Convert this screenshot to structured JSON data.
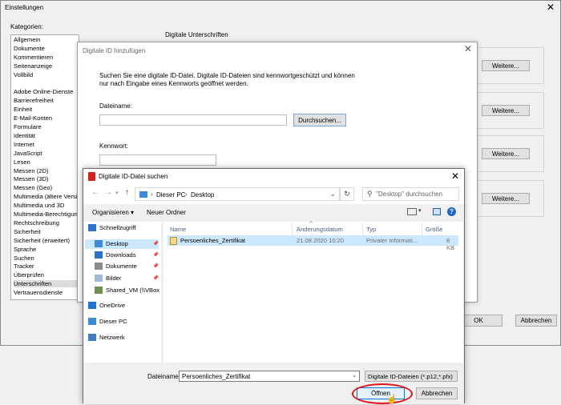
{
  "main": {
    "title": "Einstellungen",
    "categories_label": "Kategorien:",
    "categories": [
      "Allgemein",
      "Dokumente",
      "Kommentieren",
      "Seitenanzeige",
      "Vollbild",
      "",
      "Adobe Online-Dienste",
      "Barrierefreiheit",
      "Einheit",
      "E-Mail-Konten",
      "Formulare",
      "Identität",
      "Internet",
      "JavaScript",
      "Lesen",
      "Messen (2D)",
      "Messen (3D)",
      "Messen (Geo)",
      "Multimedia (ältere Versionen)",
      "Multimedia und 3D",
      "Multimedia-Berechtigungen",
      "Rechtschreibung",
      "Sicherheit",
      "Sicherheit (erweitert)",
      "Sprache",
      "Suchen",
      "Tracker",
      "Überprüfen",
      "Unterschriften",
      "Vertrauensdienste"
    ],
    "selected_category": "Unterschriften",
    "section_title": "Digitale Unterschriften",
    "more_button": "Weitere...",
    "ok_button": "OK",
    "cancel_button": "Abbrechen"
  },
  "add_id": {
    "title": "Digitale ID hinzufügen",
    "description": "Suchen Sie eine digitale ID-Datei. Digitale ID-Dateien sind kennwortgeschützt und können nur nach Eingabe eines Kennworts geöffnet werden.",
    "filename_label": "Dateiname:",
    "filename_value": "",
    "browse_button": "Durchsuchen...",
    "password_label": "Kennwort:",
    "password_value": ""
  },
  "file_dialog": {
    "title": "Digitale ID-Datei suchen",
    "breadcrumb": [
      "Dieser PC",
      "Desktop"
    ],
    "search_placeholder": "\"Desktop\" durchsuchen",
    "organize_label": "Organisieren ▾",
    "new_folder_label": "Neuer Ordner",
    "nav_items": [
      {
        "label": "Schnellzugriff",
        "icon": "star-icon",
        "pinned": false
      },
      {
        "label": "Desktop",
        "icon": "desktop-icon",
        "pinned": true
      },
      {
        "label": "Downloads",
        "icon": "download-icon",
        "pinned": true
      },
      {
        "label": "Dokumente",
        "icon": "documents-icon",
        "pinned": true
      },
      {
        "label": "Bilder",
        "icon": "pictures-icon",
        "pinned": true
      },
      {
        "label": "Shared_VM (\\\\VBox",
        "icon": "network-drive-icon",
        "pinned": false
      },
      {
        "label": "OneDrive",
        "icon": "cloud-icon",
        "pinned": false
      },
      {
        "label": "Dieser PC",
        "icon": "computer-icon",
        "pinned": false
      },
      {
        "label": "Netzwerk",
        "icon": "network-icon",
        "pinned": false
      }
    ],
    "columns": [
      "Name",
      "Änderungsdatum",
      "Typ",
      "Größe"
    ],
    "files": [
      {
        "name": "Persoenliches_Zertifikat",
        "date": "21.08.2020 10:20",
        "type": "Privater Informati...",
        "size": "8 KB"
      }
    ],
    "filename_label": "Dateiname:",
    "filename_value": "Persoenliches_Zertifikat",
    "filetype_value": "Digitale ID-Dateien (*.p12,*.pfx)",
    "open_button": "Öffnen",
    "cancel_button": "Abbrechen"
  },
  "colors": {
    "accent": "#0078d7",
    "selection": "#cce8ff",
    "highlight": "#e0161b"
  }
}
